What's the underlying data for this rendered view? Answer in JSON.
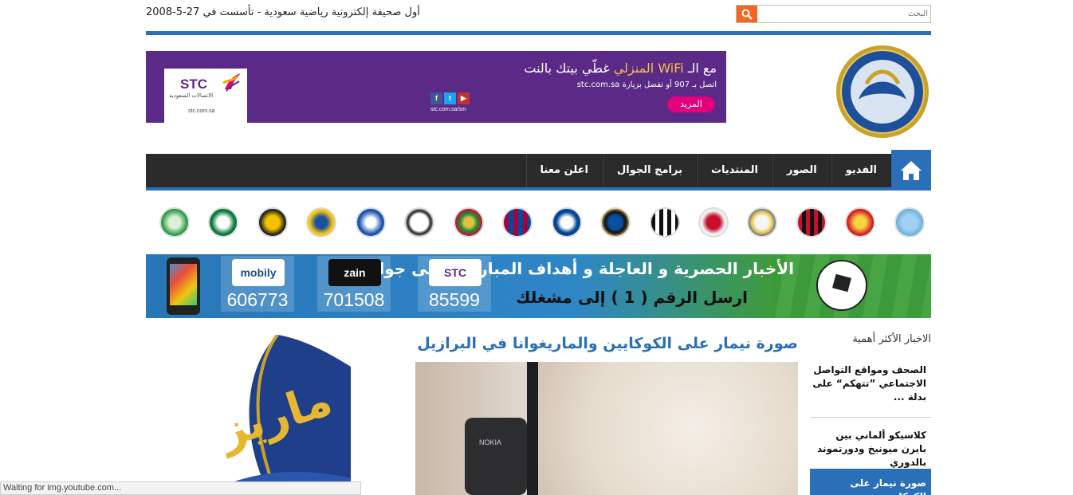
{
  "topbar": {
    "tagline": "أول صحيفة إلكترونية رياضية سعودية - تأسست في 27-5-2008",
    "search_placeholder": "البحث"
  },
  "header_ad": {
    "headline_prefix": "مع الـ ",
    "headline_wifi": "WiFi المنزلي",
    "headline_suffix": " غطّي بيتك بالنت",
    "subline": "اتصل بـ 907 أو تفضل بزيارة stc.com.sa",
    "more_button": "المزيد",
    "social_url": "stc.com.sa/sm",
    "brand_name": "STC",
    "brand_arabic": "الاتصالات السعودية",
    "brand_domain": "stc.com.sa"
  },
  "nav": {
    "items": [
      "الفديو",
      "الصور",
      "المنتديات",
      "برامج الجوال",
      "اعلن معنا"
    ]
  },
  "teams": [
    "manchester-city",
    "manchester-united",
    "ac-milan",
    "real-madrid",
    "liverpool",
    "juventus",
    "inter-milan",
    "chelsea",
    "barcelona",
    "al-ettifaq",
    "al-shabab",
    "al-hilal",
    "al-nassr",
    "al-ittihad",
    "al-ahli",
    "al-ettifaq-2"
  ],
  "sms_banner": {
    "title": "الأخبار الحصرية و العاجلة و أهداف المباريات على جوالك",
    "subtitle": "ارسل الرقم ( 1 ) إلى مشغلك",
    "operators": [
      {
        "name": "STC",
        "number": "85599",
        "color": "#5b2a86"
      },
      {
        "name": "zain",
        "number": "701508",
        "color": "#111111"
      },
      {
        "name": "mobily",
        "number": "606773",
        "color": "#1a4d8f"
      }
    ]
  },
  "sidebar": {
    "heading": "الاخبار الأكثر أهمية",
    "items": [
      "الصحف ومواقع التواصل الاجتماعي ”تتهكم“ على بدلة ...",
      "كلاسيكو ألماني بين بايرن ميونيخ ودورتموند بالدوري",
      "صورة نيمار على الكوكايين"
    ]
  },
  "article": {
    "title": "صورة نيمار على الكوكايين والماريغوانا في البرازيل",
    "phone_brand": "NOKIA"
  },
  "status_bar": "Waiting for img.youtube.com..."
}
